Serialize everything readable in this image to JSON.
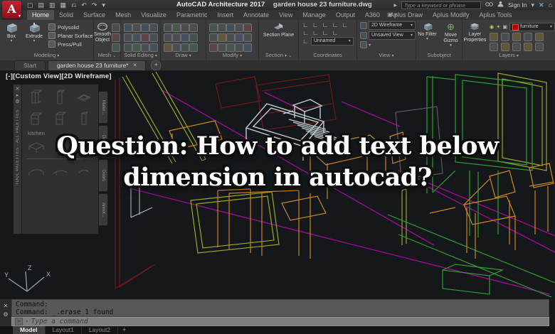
{
  "colors": {
    "canvas": "#15181b",
    "accent_red": "#b4121f",
    "wire_magenta": "#9c0a92",
    "wire_green": "#2f9e2f",
    "wire_olive": "#9aa52a",
    "wire_orange": "#cd8722",
    "wire_darkred": "#6e1818",
    "wire_selected_gray": "#c3cdd2",
    "layer_swatch": "#b30000"
  },
  "icons": {
    "app_logo": "A",
    "chevron_down": "▾",
    "chevron_right": "▸",
    "overflow": "⌄",
    "close": "✕",
    "plus": "+",
    "undo": "↶",
    "redo": "↷",
    "gear": "⚙",
    "sun": "☀",
    "bulb": "◉",
    "lock": "▣",
    "corner": "∟",
    "gizmo": "⊕",
    "prompt": "&gt;",
    "home": "⌂",
    "exchange": "✕"
  },
  "title_bar": {
    "app_title": "AutoCAD Architecture 2017",
    "doc_title": "garden house 23 furniture.dwg",
    "search_placeholder": "Type a keyword or phrase",
    "sign_in_label": "Sign In",
    "quick_icons": [
      "▢",
      "▤",
      "▥",
      "▦",
      "⎌",
      "↶",
      "↷",
      "▾"
    ]
  },
  "ribbon_tabs": {
    "items": [
      "Home",
      "Solid",
      "Surface",
      "Mesh",
      "Visualize",
      "Parametric",
      "Insert",
      "Annotate",
      "View",
      "Manage",
      "Output",
      "A360",
      "Aplus Draw",
      "Aplus Modify",
      "Aplus Tools"
    ],
    "active": "Home"
  },
  "ribbon": {
    "modeling": {
      "label": "Modeling",
      "box": "Box",
      "extrude": "Extrude",
      "polysolid": "Polysolid",
      "planar_surface": "Planar Surface",
      "press_pull": "Press/Pull"
    },
    "mesh": {
      "label": "Mesh",
      "smooth_object": "Smooth Object"
    },
    "solid_editing": {
      "label": "Solid Editing"
    },
    "draw": {
      "label": "Draw"
    },
    "modify": {
      "label": "Modify"
    },
    "section": {
      "label": "Section",
      "section_plane": "Section Plane"
    },
    "coordinates": {
      "label": "Coordinates",
      "ucs_name": "Unnamed"
    },
    "view": {
      "label": "View",
      "visual_style": "2D Wireframe",
      "named_view": "Unsaved View"
    },
    "subobject": {
      "label": "Subobject",
      "no_filter": "No Filter",
      "move_gizmo": "Move Gizmo"
    },
    "layers": {
      "label": "Layers",
      "layer_properties": "Layer Properties",
      "current_layer": "furniture"
    }
  },
  "file_tabs": {
    "items": [
      "Start",
      "garden house 23 furniture*"
    ],
    "active": "garden house 23 furniture*"
  },
  "viewport": {
    "label": "[-][Custom View][2D Wireframe]"
  },
  "palette": {
    "title": "TOOL PALETTES - ALL PALETTES",
    "group": "kitchen",
    "tabs": [
      "Mater...",
      "Details",
      "Doors",
      "Annot..."
    ]
  },
  "overlay": {
    "line1": "Question: How to add text below",
    "line2": "dimension in autocad?"
  },
  "command": {
    "history": [
      "Command:",
      "Command: _.erase 1 found"
    ],
    "placeholder": "Type a command"
  },
  "layout_tabs": {
    "items": [
      "Model",
      "Layout1",
      "Layout2"
    ],
    "active": "Model"
  },
  "ucs_axes": {
    "x": "X",
    "y": "Y",
    "z": "Z"
  }
}
